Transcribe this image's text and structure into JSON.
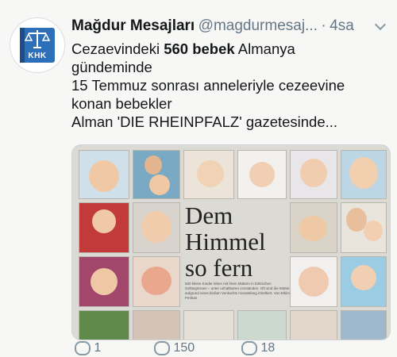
{
  "tweet": {
    "display_name": "Mağdur Mesajları",
    "handle": "@magdurmesaj...",
    "separator": "·",
    "time": "4sa",
    "avatar_text": "KHK",
    "text": {
      "line1_prefix": "Cezaevindeki ",
      "line1_bold": "560 bebek",
      "line1_suffix": " Almanya",
      "line2": "gündeminde",
      "line3": "15 Temmuz sonrası anneleriyle cezeevine",
      "line4": "konan bebekler",
      "line5": "Alman 'DIE RHEINPFALZ' gazetesinde..."
    },
    "media": {
      "headline_line1": "Dem",
      "headline_line2": "Himmel",
      "headline_line3": "so fern",
      "small_text": "560 kleine Kinder leben mit ihren Müttern in türkischen Gefängnissen – unter unhaltbaren Umständen. Oft sind die Mütter aufgrund eines bloßen Verdachts monatelang inhaftiert. Von Elkim Perikan"
    },
    "actions": {
      "reply_count": "1",
      "retweet_count": "150",
      "like_count": "18"
    }
  }
}
